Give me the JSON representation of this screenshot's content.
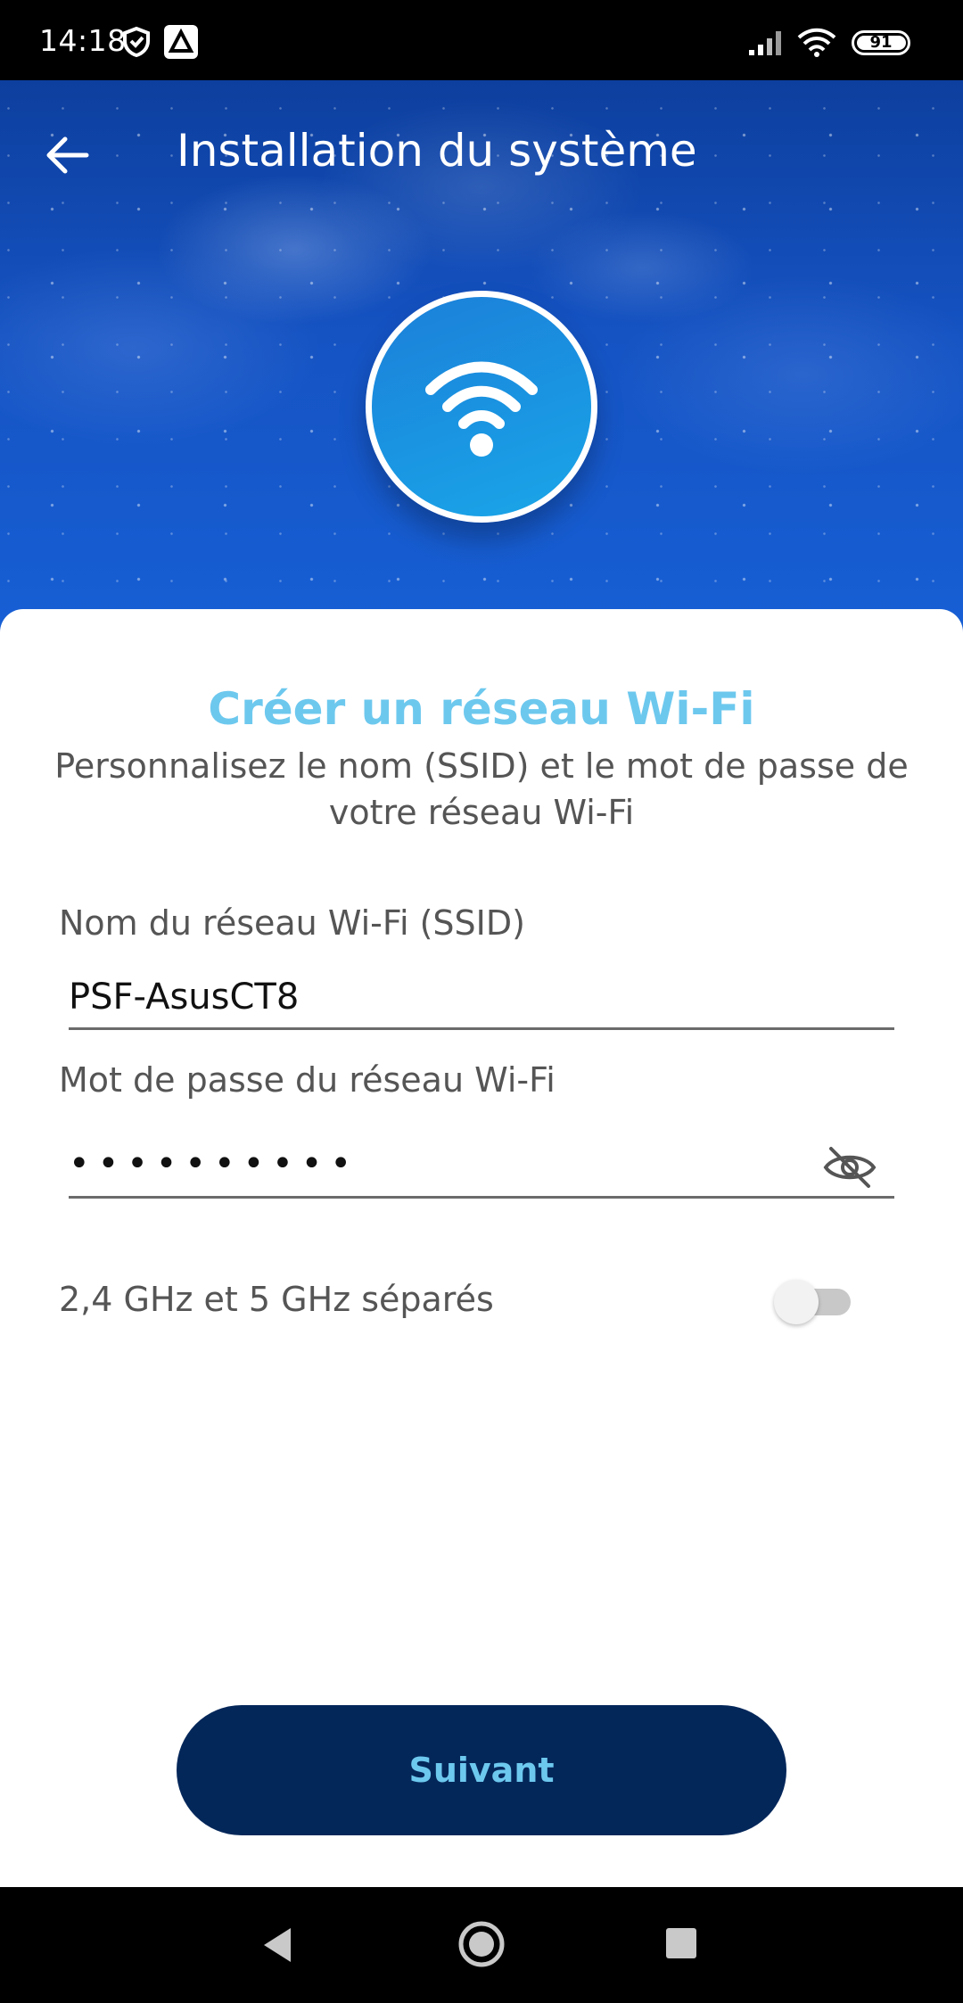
{
  "status_bar": {
    "time": "14:18",
    "battery": "91",
    "icons": [
      "shield-icon",
      "app-icon",
      "signal-icon",
      "wifi-icon",
      "battery-icon"
    ]
  },
  "header": {
    "title": "Installation du système",
    "back_icon": "arrow-left-icon"
  },
  "hero": {
    "badge_icon": "wifi-icon"
  },
  "form": {
    "title": "Créer un réseau Wi-Fi",
    "subtitle": "Personnalisez le nom (SSID) et le mot de passe de votre réseau Wi-Fi",
    "ssid_label": "Nom du réseau Wi-Fi (SSID)",
    "ssid_value": "PSF-AsusCT8",
    "password_label": "Mot de passe du réseau Wi-Fi",
    "password_value": "••••••••••",
    "password_visibility_icon": "eye-off-icon",
    "separate_bands_label": "2,4 GHz et 5 GHz séparés",
    "separate_bands_enabled": false,
    "next_label": "Suivant"
  },
  "colors": {
    "accent": "#6dc8ee",
    "button_bg": "#04275a",
    "hero_blue": "#1553c3"
  },
  "nav_bar": {
    "icons": [
      "nav-back-icon",
      "nav-home-icon",
      "nav-recents-icon"
    ]
  }
}
